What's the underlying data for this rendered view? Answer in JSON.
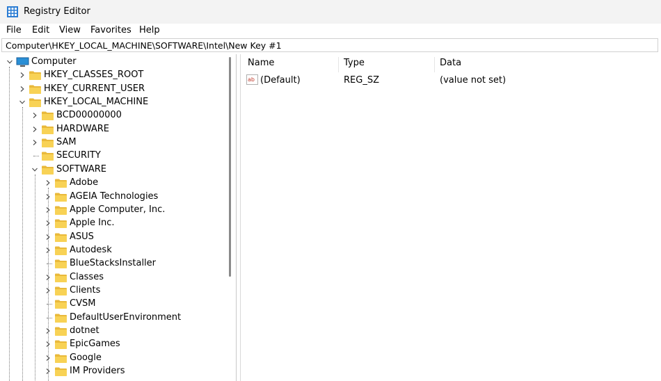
{
  "window": {
    "title": "Registry Editor"
  },
  "menu": [
    "File",
    "Edit",
    "View",
    "Favorites",
    "Help"
  ],
  "address": {
    "path": "Computer\\HKEY_LOCAL_MACHINE\\SOFTWARE\\Intel\\New Key #1"
  },
  "tree": {
    "root": "Computer",
    "hives": [
      "HKEY_CLASSES_ROOT",
      "HKEY_CURRENT_USER",
      "HKEY_LOCAL_MACHINE"
    ],
    "hklm_children": [
      "BCD00000000",
      "HARDWARE",
      "SAM",
      "SECURITY",
      "SOFTWARE"
    ],
    "software_children": [
      "Adobe",
      "AGEIA Technologies",
      "Apple Computer, Inc.",
      "Apple Inc.",
      "ASUS",
      "Autodesk",
      "BlueStacksInstaller",
      "Classes",
      "Clients",
      "CVSM",
      "DefaultUserEnvironment",
      "dotnet",
      "EpicGames",
      "Google",
      "IM Providers"
    ]
  },
  "list": {
    "columns": [
      "Name",
      "Type",
      "Data"
    ],
    "rows": [
      {
        "name": "(Default)",
        "type": "REG_SZ",
        "data": "(value not set)",
        "icon": "string-value-icon"
      }
    ]
  },
  "colors": {
    "folder": "#f8d255",
    "folder_dark": "#e9b93b",
    "computer": "#2a8fd6",
    "titlebar": "#f3f3f3"
  }
}
